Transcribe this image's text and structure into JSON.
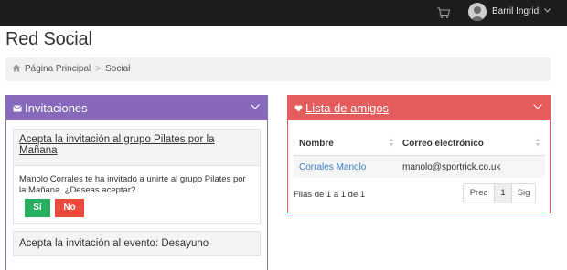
{
  "header": {
    "user_name": "Barril Ingrid",
    "icons": [
      "cart-icon",
      "avatar",
      "chevron-down-icon"
    ]
  },
  "page": {
    "title": "Red Social"
  },
  "breadcrumb": {
    "items": [
      "Página Principal",
      "Social"
    ],
    "separator": ">"
  },
  "invitations_panel": {
    "title": "Invitaciones",
    "accent_color": "#8769bb",
    "items": [
      {
        "title": "Acepta la invitación al grupo Pilates por la Mañana",
        "message": "Manolo Corrales te ha invitado a unirte al grupo Pilates por la Mañana. ¿Deseas aceptar?",
        "accept_label": "Sí",
        "reject_label": "No"
      },
      {
        "title": "Acepta la invitación al evento: Desayuno"
      }
    ]
  },
  "friends_panel": {
    "title": "Lista de amigos",
    "accent_color": "#e55c5c",
    "columns": [
      "Nombre",
      "Correo electrónico"
    ],
    "rows": [
      [
        "Corrales Manolo",
        "manolo@sportrick.co.uk"
      ]
    ],
    "info": "Filas de 1 a 1 de 1",
    "pagination": {
      "prev": "Prec",
      "current": "1",
      "next": "Sig"
    }
  }
}
